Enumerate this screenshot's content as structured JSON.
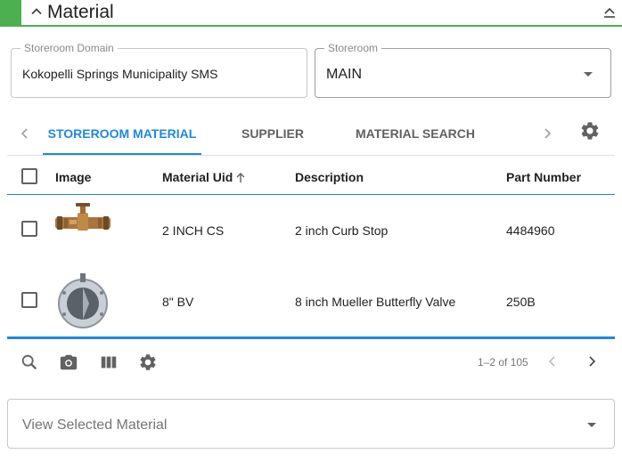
{
  "header": {
    "title": "Material"
  },
  "storeroom_domain": {
    "label": "Storeroom Domain",
    "value": "Kokopelli Springs Municipality SMS"
  },
  "storeroom": {
    "label": "Storeroom",
    "value": "MAIN"
  },
  "tabs": [
    {
      "label": "STOREROOM MATERIAL",
      "active": true
    },
    {
      "label": "SUPPLIER",
      "active": false
    },
    {
      "label": "MATERIAL SEARCH",
      "active": false
    }
  ],
  "table": {
    "columns": {
      "image": "Image",
      "uid": "Material Uid",
      "description": "Description",
      "part_number": "Part Number"
    },
    "sort": {
      "column": "Material Uid",
      "direction": "ascending"
    },
    "rows": [
      {
        "image_icon": "curb-stop-photo",
        "uid": "2 INCH CS",
        "description": "2 inch Curb Stop",
        "part_number": "4484960"
      },
      {
        "image_icon": "butterfly-valve-photo",
        "uid": "8\" BV",
        "description": "8 inch Mueller Butterfly Valve",
        "part_number": "250B"
      }
    ]
  },
  "pager": {
    "text": "1–2 of 105"
  },
  "view_selected": {
    "placeholder": "View Selected Material"
  },
  "colors": {
    "accent_green": "#4caf50",
    "active_blue": "#1e88e5",
    "icon_gray": "#616161"
  }
}
